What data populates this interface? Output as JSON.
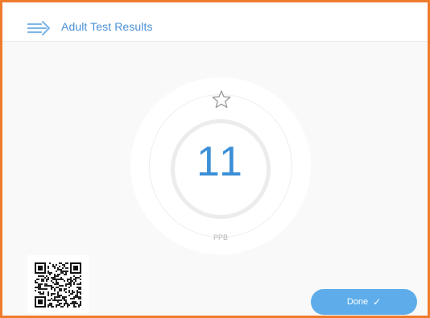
{
  "header": {
    "title": "Adult Test Results",
    "icon": "breath-arrow-icon"
  },
  "result": {
    "value": "11",
    "unit": "PPB",
    "rating_icon": "star-outline-icon"
  },
  "footer": {
    "qr_icon": "qr-code-icon",
    "done_label": "Done",
    "done_icon": "check-icon"
  },
  "colors": {
    "accent": "#3b8fd6",
    "button": "#5eadea",
    "frame_border": "#ef7b2c"
  }
}
